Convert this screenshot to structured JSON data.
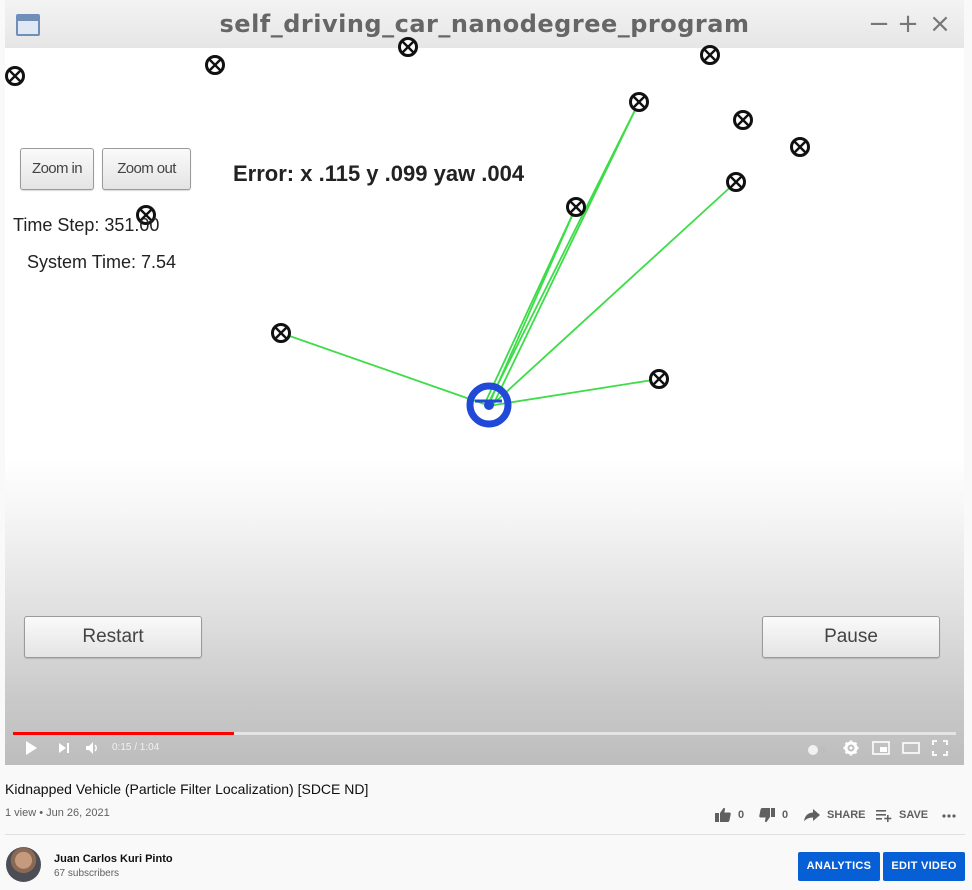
{
  "sim": {
    "window_title": "self_driving_car_nanodegree_program",
    "window_buttons": {
      "minimize": "−",
      "maximize": "+",
      "close": "×"
    },
    "zoom_in_label": "Zoom in",
    "zoom_out_label": "Zoom out",
    "time_step_text": "Time Step: 351.00",
    "system_time_text": "System Time: 7.54",
    "error_text": "Error: x .115 y .099 yaw .004",
    "restart_label": "Restart",
    "pause_label": "Pause",
    "colors": {
      "observation_line": "#3ddc48",
      "vehicle": "#1f49d6",
      "landmark": "#111111"
    }
  },
  "player": {
    "time_text": "0:15 / 1:04",
    "progress": 0.234,
    "progress_color": "#ff0000",
    "icons": [
      "play-icon",
      "next-icon",
      "volume-icon",
      "autoplay-toggle-icon",
      "settings-icon",
      "miniplayer-icon",
      "theater-icon",
      "fullscreen-icon"
    ]
  },
  "video": {
    "title": "Kidnapped Vehicle (Particle Filter Localization) [SDCE ND]",
    "views_date": "1 view • Jun 26, 2021"
  },
  "actions": {
    "like_count": "0",
    "dislike_count": "0",
    "share_label": "SHARE",
    "save_label": "SAVE"
  },
  "channel": {
    "name": "Juan Carlos Kuri Pinto",
    "subscribers": "67 subscribers"
  },
  "buttons": {
    "analytics_label": "ANALYTICS",
    "edit_video_label": "EDIT VIDEO",
    "accent_color": "#065fd4"
  }
}
